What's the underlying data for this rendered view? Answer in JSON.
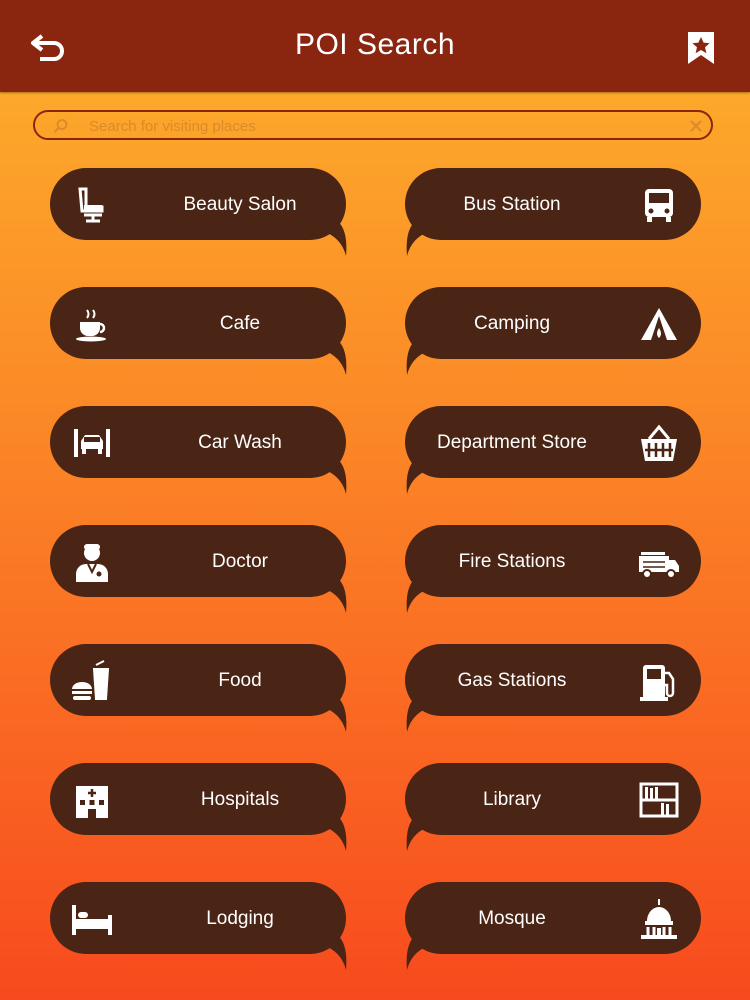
{
  "header": {
    "title": "POI Search",
    "back_icon": "back-arrow-icon",
    "bookmark_icon": "bookmark-star-icon",
    "bar_color": "#8a2610"
  },
  "search": {
    "placeholder": "Search for visiting places",
    "value": ""
  },
  "tile_color": "#4a2414",
  "categories": [
    {
      "label": "Beauty Salon",
      "icon": "salon-chair-icon"
    },
    {
      "label": "Bus Station",
      "icon": "bus-icon"
    },
    {
      "label": "Cafe",
      "icon": "coffee-cup-icon"
    },
    {
      "label": "Camping",
      "icon": "tent-icon"
    },
    {
      "label": "Car Wash",
      "icon": "car-wash-icon"
    },
    {
      "label": "Department Store",
      "icon": "shopping-basket-icon"
    },
    {
      "label": "Doctor",
      "icon": "doctor-icon"
    },
    {
      "label": "Fire Stations",
      "icon": "fire-truck-icon"
    },
    {
      "label": "Food",
      "icon": "burger-drink-icon"
    },
    {
      "label": "Gas Stations",
      "icon": "gas-pump-icon"
    },
    {
      "label": "Hospitals",
      "icon": "hospital-building-icon"
    },
    {
      "label": "Library",
      "icon": "bookshelf-icon"
    },
    {
      "label": "Lodging",
      "icon": "bed-icon"
    },
    {
      "label": "Mosque",
      "icon": "dome-icon"
    }
  ]
}
